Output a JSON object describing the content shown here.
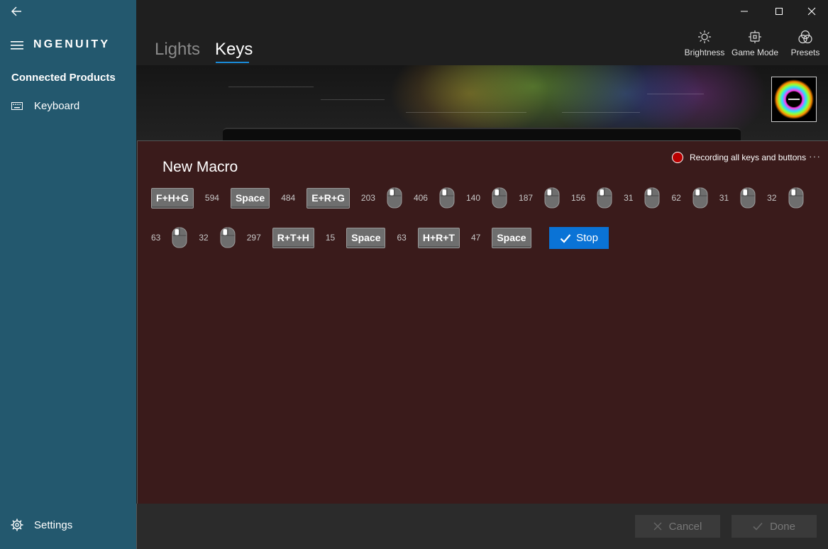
{
  "app": {
    "brand": "NGENUITY"
  },
  "sidebar": {
    "heading": "Connected Products",
    "items": [
      {
        "label": "Keyboard",
        "icon": "keyboard-icon"
      }
    ],
    "settings_label": "Settings"
  },
  "header": {
    "tabs": [
      {
        "label": "Lights",
        "active": false
      },
      {
        "label": "Keys",
        "active": true
      }
    ],
    "tools": [
      {
        "label": "Brightness",
        "icon": "brightness-icon"
      },
      {
        "label": "Game Mode",
        "icon": "game-mode-icon"
      },
      {
        "label": "Presets",
        "icon": "presets-icon"
      }
    ],
    "window_controls": [
      "minimize-icon",
      "maximize-icon",
      "close-icon"
    ]
  },
  "macro": {
    "title": "New Macro",
    "recording_status": "Recording all keys and buttons",
    "more": "···",
    "row1": [
      {
        "type": "key",
        "label": "F+H+G"
      },
      {
        "type": "delay",
        "label": "594"
      },
      {
        "type": "key",
        "label": "Space"
      },
      {
        "type": "delay",
        "label": "484"
      },
      {
        "type": "key",
        "label": "E+R+G"
      },
      {
        "type": "delay",
        "label": "203"
      },
      {
        "type": "mouse"
      },
      {
        "type": "delay",
        "label": "406"
      },
      {
        "type": "mouse"
      },
      {
        "type": "delay",
        "label": "140"
      },
      {
        "type": "mouse"
      },
      {
        "type": "delay",
        "label": "187"
      },
      {
        "type": "mouse"
      },
      {
        "type": "delay",
        "label": "156"
      },
      {
        "type": "mouse"
      },
      {
        "type": "delay",
        "label": "31"
      },
      {
        "type": "mouse"
      },
      {
        "type": "delay",
        "label": "62"
      },
      {
        "type": "mouse"
      },
      {
        "type": "delay",
        "label": "31"
      },
      {
        "type": "mouse"
      },
      {
        "type": "delay",
        "label": "32"
      },
      {
        "type": "mouse"
      }
    ],
    "row2": [
      {
        "type": "delay",
        "label": "63"
      },
      {
        "type": "mouse"
      },
      {
        "type": "delay",
        "label": "32"
      },
      {
        "type": "mouse"
      },
      {
        "type": "delay",
        "label": "297"
      },
      {
        "type": "key",
        "label": "R+T+H"
      },
      {
        "type": "delay",
        "label": "15"
      },
      {
        "type": "key",
        "label": "Space"
      },
      {
        "type": "delay",
        "label": "63"
      },
      {
        "type": "key",
        "label": "H+R+T"
      },
      {
        "type": "delay",
        "label": "47"
      },
      {
        "type": "key",
        "label": "Space"
      }
    ],
    "stop_label": "Stop"
  },
  "footer": {
    "cancel_label": "Cancel",
    "done_label": "Done"
  },
  "colors": {
    "sidebar": "#23586e",
    "panel": "#3a1b1b",
    "accent": "#0a73d6",
    "record": "#b80000"
  }
}
